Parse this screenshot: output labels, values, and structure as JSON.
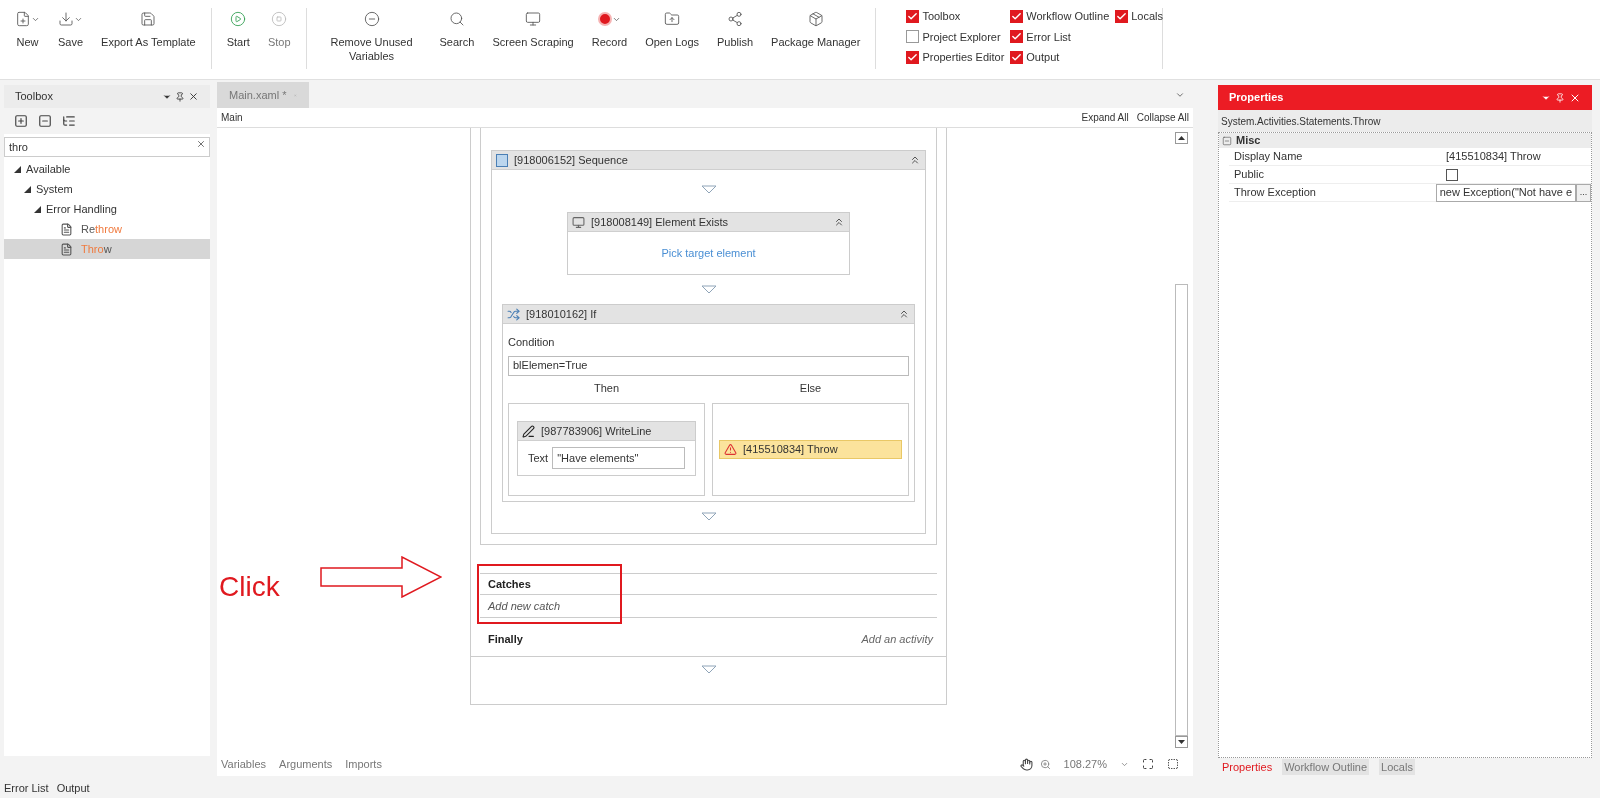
{
  "ribbon": {
    "groups": [
      [
        {
          "label": "New",
          "menu": true
        },
        {
          "label": "Save",
          "menu": true
        },
        {
          "label": "Export As Template",
          "menu": false
        }
      ],
      [
        {
          "label": "Start",
          "menu": false,
          "disabled": false
        },
        {
          "label": "Stop",
          "menu": false,
          "disabled": true
        }
      ],
      [
        {
          "label": "Remove Unused Variables",
          "menu": false
        },
        {
          "label": "Search",
          "menu": false
        },
        {
          "label": "Screen Scraping",
          "menu": false
        },
        {
          "label": "Record",
          "menu": true
        },
        {
          "label": "Open Logs",
          "menu": false
        },
        {
          "label": "Publish",
          "menu": false
        },
        {
          "label": "Package Manager",
          "menu": false
        }
      ]
    ],
    "panel_toggles": [
      [
        {
          "label": "Toolbox",
          "checked": true
        },
        {
          "label": "Project Explorer",
          "checked": false
        },
        {
          "label": "Properties Editor",
          "checked": true
        }
      ],
      [
        {
          "label": "Workflow Outline",
          "checked": true
        },
        {
          "label": "Error List",
          "checked": true
        },
        {
          "label": "Output",
          "checked": true
        }
      ],
      [
        {
          "label": "Locals",
          "checked": true
        }
      ]
    ]
  },
  "toolbox": {
    "title": "Toolbox",
    "search": {
      "value": "thro"
    },
    "tree": [
      {
        "label": "Available",
        "expanded": true,
        "children": [
          {
            "label": "System",
            "expanded": true,
            "children": [
              {
                "label": "Error Handling",
                "expanded": true,
                "children": [
                  {
                    "parts": [
                      {
                        "text": "Re",
                        "match": false
                      },
                      {
                        "text": "throw",
                        "match": true
                      }
                    ],
                    "selected": false
                  },
                  {
                    "parts": [
                      {
                        "text": "Thro",
                        "match": true
                      },
                      {
                        "text": "w",
                        "match": false
                      }
                    ],
                    "selected": true
                  }
                ]
              }
            ]
          }
        ]
      }
    ]
  },
  "designer": {
    "tab": "Main.xaml *",
    "breadcrumb": "Main",
    "expand_all": "Expand All",
    "collapse_all": "Collapse All",
    "sequence": {
      "title": "[918006152] Sequence",
      "selected": false
    },
    "element_exists": {
      "title": "[918008149] Element Exists",
      "selected": false,
      "link": "Pick target element"
    },
    "if": {
      "title": "[918010162] If",
      "selected": false,
      "condition_label": "Condition",
      "condition": "blElemen=True",
      "then_label": "Then",
      "else_label": "Else"
    },
    "writeline": {
      "title": "[987783906] WriteLine",
      "selected": false,
      "text_label": "Text",
      "text_value": "\"Have elements\""
    },
    "throw": {
      "title": "[415510834] Throw",
      "selected": true
    },
    "catches": {
      "title": "Catches",
      "placeholder": "Add new catch"
    },
    "finally": {
      "title": "Finally",
      "add": "Add an activity"
    },
    "annotation": {
      "text": "Click"
    },
    "bottom_tabs": [
      "Variables",
      "Arguments",
      "Imports"
    ],
    "zoom": "108.27%"
  },
  "properties": {
    "title": "Properties",
    "type": "System.Activities.Statements.Throw",
    "category": "Misc",
    "rows": [
      {
        "kind": "text",
        "label": "Display Name",
        "value": "[415510834] Throw"
      },
      {
        "kind": "checkbox",
        "label": "Public",
        "checked": false
      },
      {
        "kind": "field",
        "label": "Throw Exception",
        "value": "new Exception(\"Not have e",
        "button": "..."
      }
    ],
    "tabs": [
      {
        "label": "Properties",
        "selected": true
      },
      {
        "label": "Workflow Outline",
        "selected": false
      },
      {
        "label": "Locals",
        "selected": false
      }
    ]
  },
  "status_bar": [
    "Error List",
    "Output"
  ]
}
